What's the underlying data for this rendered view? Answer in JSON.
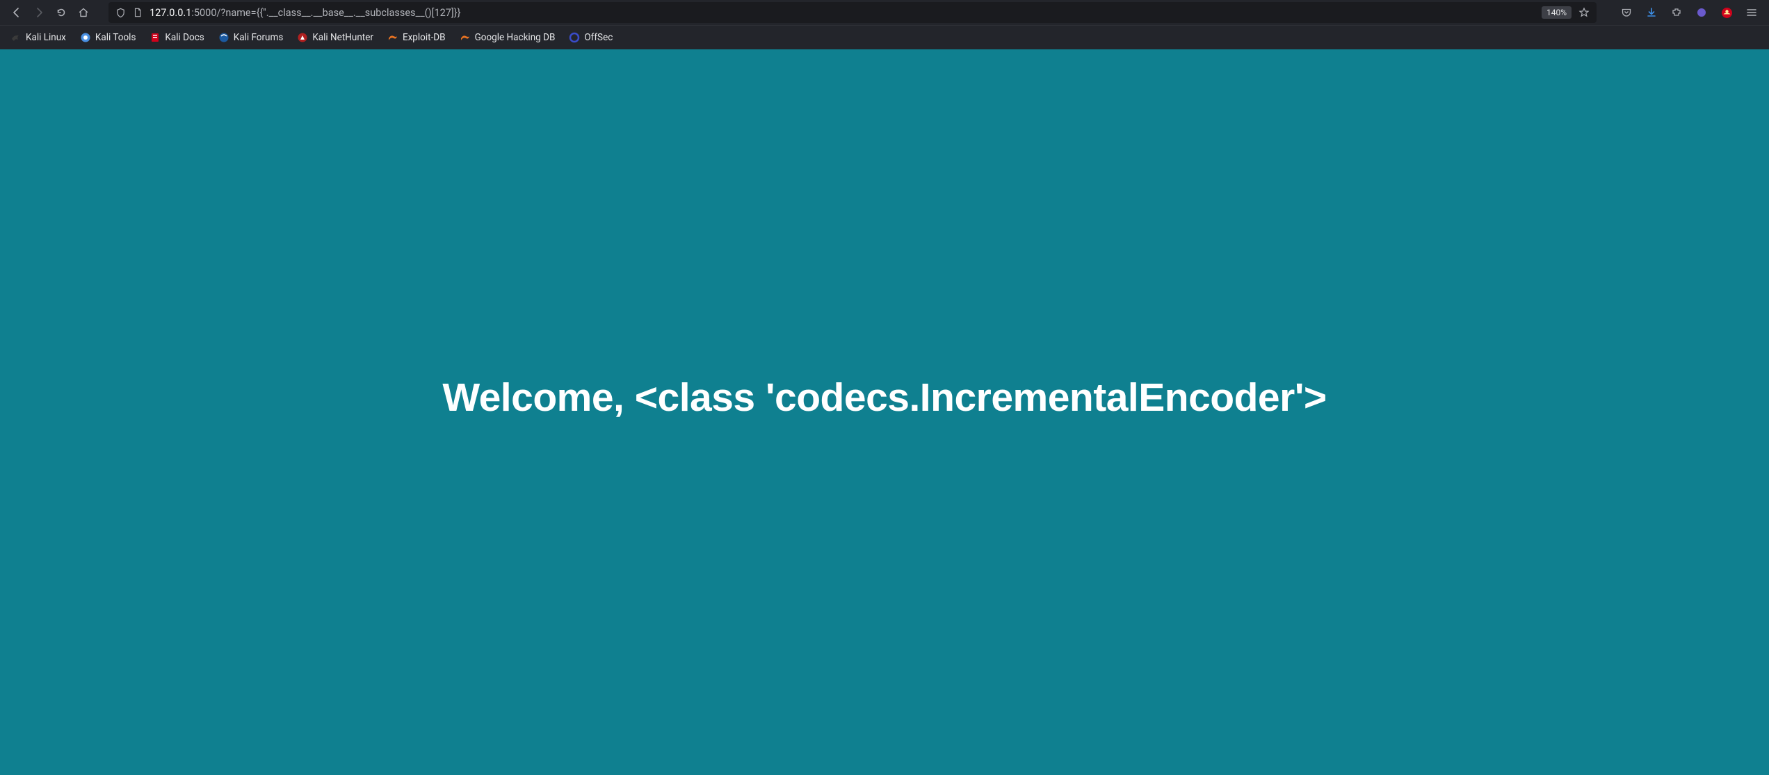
{
  "toolbar": {
    "url_host": "127.0.0.1",
    "url_path": ":5000/?name={{''.__class__.__base__.__subclasses__()[127]}}",
    "zoom": "140%"
  },
  "bookmarks": [
    {
      "label": "Kali Linux",
      "icon": "dragon-icon",
      "color": "#333333"
    },
    {
      "label": "Kali Tools",
      "icon": "tools-icon",
      "color": "#4a90e2"
    },
    {
      "label": "Kali Docs",
      "icon": "docs-icon",
      "color": "#d0021b"
    },
    {
      "label": "Kali Forums",
      "icon": "forums-icon",
      "color": "#1c5aa0"
    },
    {
      "label": "Kali NetHunter",
      "icon": "hunter-icon",
      "color": "#b02020"
    },
    {
      "label": "Exploit-DB",
      "icon": "exploit-icon",
      "color": "#e67222"
    },
    {
      "label": "Google Hacking DB",
      "icon": "ghdb-icon",
      "color": "#e67222"
    },
    {
      "label": "OffSec",
      "icon": "offsec-icon",
      "color": "#3a4cc9"
    }
  ],
  "page": {
    "heading": "Welcome, <class 'codecs.IncrementalEncoder'>"
  }
}
